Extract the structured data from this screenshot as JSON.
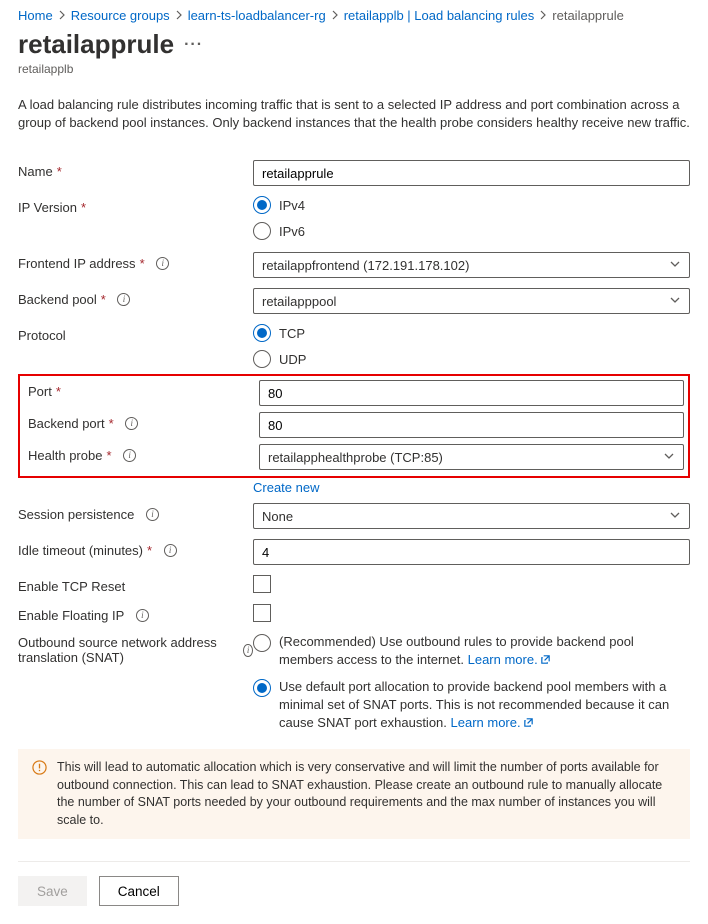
{
  "breadcrumb": {
    "home": "Home",
    "rg": "Resource groups",
    "rgname": "learn-ts-loadbalancer-rg",
    "lb": "retailapplb | Load balancing rules",
    "current": "retailapprule"
  },
  "header": {
    "title": "retailapprule",
    "subtitle": "retailapplb"
  },
  "description": "A load balancing rule distributes incoming traffic that is sent to a selected IP address and port combination across a group of backend pool instances. Only backend instances that the health probe considers healthy receive new traffic.",
  "labels": {
    "name": "Name",
    "ipversion": "IP Version",
    "frontend": "Frontend IP address",
    "backendpool": "Backend pool",
    "protocol": "Protocol",
    "port": "Port",
    "backendport": "Backend port",
    "healthprobe": "Health probe",
    "createnew": "Create new",
    "session": "Session persistence",
    "idle": "Idle timeout (minutes)",
    "tcpreset": "Enable TCP Reset",
    "floating": "Enable Floating IP",
    "snat": "Outbound source network address translation (SNAT)",
    "learnmore": "Learn more."
  },
  "values": {
    "name": "retailapprule",
    "ipv4": "IPv4",
    "ipv6": "IPv6",
    "frontend": "retailappfrontend (172.191.178.102)",
    "backendpool": "retailapppool",
    "tcp": "TCP",
    "udp": "UDP",
    "port": "80",
    "backendport": "80",
    "healthprobe": "retailapphealthprobe (TCP:85)",
    "session": "None",
    "idle": "4",
    "snat_opt1": "(Recommended) Use outbound rules to provide backend pool members access to the internet.",
    "snat_opt2": "Use default port allocation to provide backend pool members with a minimal set of SNAT ports. This is not recommended because it can cause SNAT port exhaustion."
  },
  "warning": "This will lead to automatic allocation which is very conservative and will limit the number of ports available for outbound connection. This can lead to SNAT exhaustion. Please create an outbound rule to manually allocate the number of SNAT ports needed by your outbound requirements and the max number of instances you will scale to.",
  "buttons": {
    "save": "Save",
    "cancel": "Cancel"
  }
}
